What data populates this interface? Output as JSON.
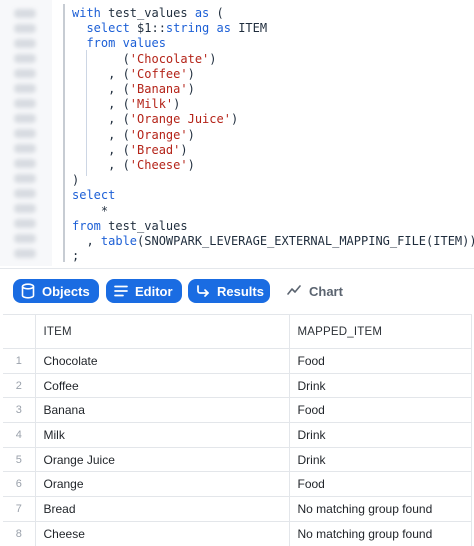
{
  "editor": {
    "code_lines": [
      {
        "parts": [
          {
            "t": "with",
            "c": "kw"
          },
          {
            "t": " test_values ",
            "c": "punct"
          },
          {
            "t": "as",
            "c": "kw"
          },
          {
            "t": " (",
            "c": "punct"
          }
        ]
      },
      {
        "parts": [
          {
            "t": "  select",
            "c": "kw"
          },
          {
            "t": " $1::",
            "c": "punct"
          },
          {
            "t": "string",
            "c": "kw"
          },
          {
            "t": " ",
            "c": "punct"
          },
          {
            "t": "as",
            "c": "kw"
          },
          {
            "t": " ITEM",
            "c": "punct"
          }
        ]
      },
      {
        "parts": [
          {
            "t": "  from",
            "c": "kw"
          },
          {
            "t": " ",
            "c": "punct"
          },
          {
            "t": "values",
            "c": "kw"
          }
        ]
      },
      {
        "parts": [
          {
            "t": "       (",
            "c": "punct"
          },
          {
            "t": "'Chocolate'",
            "c": "str"
          },
          {
            "t": ")",
            "c": "punct"
          }
        ]
      },
      {
        "parts": [
          {
            "t": "     , (",
            "c": "punct"
          },
          {
            "t": "'Coffee'",
            "c": "str"
          },
          {
            "t": ")",
            "c": "punct"
          }
        ]
      },
      {
        "parts": [
          {
            "t": "     , (",
            "c": "punct"
          },
          {
            "t": "'Banana'",
            "c": "str"
          },
          {
            "t": ")",
            "c": "punct"
          }
        ]
      },
      {
        "parts": [
          {
            "t": "     , (",
            "c": "punct"
          },
          {
            "t": "'Milk'",
            "c": "str"
          },
          {
            "t": ")",
            "c": "punct"
          }
        ]
      },
      {
        "parts": [
          {
            "t": "     , (",
            "c": "punct"
          },
          {
            "t": "'Orange Juice'",
            "c": "str"
          },
          {
            "t": ")",
            "c": "punct"
          }
        ]
      },
      {
        "parts": [
          {
            "t": "     , (",
            "c": "punct"
          },
          {
            "t": "'Orange'",
            "c": "str"
          },
          {
            "t": ")",
            "c": "punct"
          }
        ]
      },
      {
        "parts": [
          {
            "t": "     , (",
            "c": "punct"
          },
          {
            "t": "'Bread'",
            "c": "str"
          },
          {
            "t": ")",
            "c": "punct"
          }
        ]
      },
      {
        "parts": [
          {
            "t": "     , (",
            "c": "punct"
          },
          {
            "t": "'Cheese'",
            "c": "str"
          },
          {
            "t": ")",
            "c": "punct"
          }
        ]
      },
      {
        "parts": [
          {
            "t": ")",
            "c": "punct"
          }
        ]
      },
      {
        "parts": [
          {
            "t": "select",
            "c": "kw"
          }
        ]
      },
      {
        "parts": [
          {
            "t": "    *",
            "c": "punct"
          }
        ]
      },
      {
        "parts": [
          {
            "t": "from",
            "c": "kw"
          },
          {
            "t": " test_values",
            "c": "punct"
          }
        ]
      },
      {
        "parts": [
          {
            "t": "  , ",
            "c": "punct"
          },
          {
            "t": "table",
            "c": "kw"
          },
          {
            "t": "(SNOWPARK_LEVERAGE_EXTERNAL_MAPPING_FILE(ITEM))",
            "c": "punct"
          }
        ]
      },
      {
        "parts": [
          {
            "t": ";",
            "c": "punct"
          }
        ]
      }
    ]
  },
  "toolbar": {
    "objects_label": "Objects",
    "editor_label": "Editor",
    "results_label": "Results",
    "chart_label": "Chart",
    "objects_icon": "database-icon",
    "editor_icon": "menu-lines-icon",
    "results_icon": "return-arrow-icon",
    "chart_icon": "line-chart-icon",
    "accent_color": "#1a6ce2"
  },
  "results": {
    "columns": [
      "ITEM",
      "MAPPED_ITEM"
    ],
    "rows": [
      {
        "num": "1",
        "item": "Chocolate",
        "mapped": "Food"
      },
      {
        "num": "2",
        "item": "Coffee",
        "mapped": "Drink"
      },
      {
        "num": "3",
        "item": "Banana",
        "mapped": "Food"
      },
      {
        "num": "4",
        "item": "Milk",
        "mapped": "Drink"
      },
      {
        "num": "5",
        "item": "Orange Juice",
        "mapped": "Drink"
      },
      {
        "num": "6",
        "item": "Orange",
        "mapped": "Food"
      },
      {
        "num": "7",
        "item": "Bread",
        "mapped": "No matching group found"
      },
      {
        "num": "8",
        "item": "Cheese",
        "mapped": "No matching group found"
      }
    ]
  }
}
